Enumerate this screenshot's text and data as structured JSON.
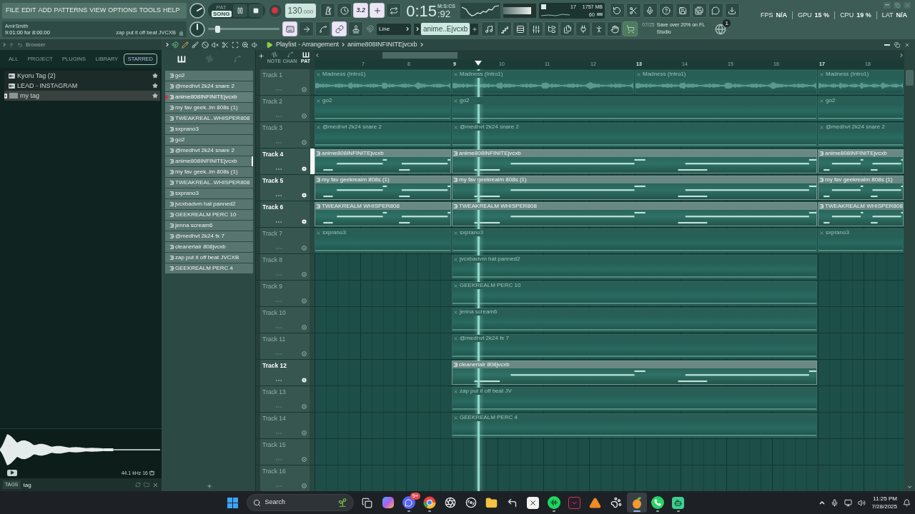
{
  "toolbar": {
    "menu": [
      "FILE",
      "EDIT",
      "ADD",
      "PATTERNS",
      "VIEW",
      "OPTIONS",
      "TOOLS",
      "HELP"
    ],
    "hint": {
      "title": "AmirSmith",
      "time": "9:01:00 for 8:00:00",
      "message": "zap put it off beat JVCXB"
    },
    "modes": [
      {
        "label": "PAT",
        "selected": false
      },
      {
        "label": "SONG",
        "selected": true
      }
    ],
    "tempo": {
      "value": "130",
      "decimals": ".000"
    },
    "toggles_top": [
      {
        "kind": "metronome",
        "on": false
      },
      {
        "kind": "wait",
        "on": false
      },
      {
        "kind": "countdown",
        "label": "3.2",
        "on": true
      },
      {
        "kind": "blend",
        "on": true
      },
      {
        "kind": "loop",
        "on": false
      }
    ],
    "time": {
      "value": "0:15",
      "centis": ":92",
      "unit": "M:S:CS"
    },
    "meter": {
      "level": 0.85
    },
    "usage": {
      "voices": "17",
      "memory": "1757 MB",
      "polyphony": "60"
    },
    "pitch": {
      "level": 0.13
    },
    "toggles_bottom": [
      {
        "kind": "typing",
        "on": true
      },
      {
        "kind": "arrow",
        "on": false
      },
      {
        "kind": "curve",
        "on": false
      },
      {
        "kind": "link",
        "on": true
      },
      {
        "kind": "stamp",
        "on": false
      }
    ],
    "snap": {
      "value": "Line"
    },
    "pattern": {
      "value": "anime..Ejvcxb"
    },
    "news": {
      "date": "07/25",
      "text": "Save over 20% on FL Studio",
      "badge": "1"
    },
    "stats": [
      {
        "label": "FPS",
        "value": "N/A"
      },
      {
        "label": "GPU",
        "value": "15 %"
      },
      {
        "label": "CPU",
        "value": "19 %"
      },
      {
        "label": "LAT",
        "value": "N/A"
      }
    ]
  },
  "browser": {
    "title": "Browser",
    "tabs": [
      {
        "label": "ALL",
        "selected": false
      },
      {
        "label": "PROJECT",
        "selected": false
      },
      {
        "label": "PLUGINS",
        "selected": false
      },
      {
        "label": "LIBRARY",
        "selected": false
      },
      {
        "label": "STARRED",
        "selected": true
      }
    ],
    "items": [
      {
        "kind": "folder",
        "label": "Kyoru Tag (2)",
        "selected": false,
        "starred": true
      },
      {
        "kind": "folder",
        "label": "LEAD - INSTAGRAM",
        "selected": false,
        "starred": true
      },
      {
        "kind": "tag",
        "label": "my tag",
        "selected": true,
        "starred": true
      }
    ],
    "preview": {
      "info": "44.1 kHz 16"
    },
    "tags": {
      "label": "TAGS",
      "value": "tag"
    }
  },
  "picker": {
    "tabs": [
      {
        "kind": "patterns",
        "selected": true
      },
      {
        "kind": "audio",
        "selected": false
      },
      {
        "kind": "automation",
        "selected": false
      }
    ],
    "items": [
      {
        "label": "go2",
        "selected": false,
        "current": false
      },
      {
        "label": "@medhvt 2k24 snare 2",
        "selected": false,
        "current": false
      },
      {
        "label": "anime808INFINITEjvcxb",
        "selected": true,
        "current": false
      },
      {
        "label": "my fav geek..lm 808s (1)",
        "selected": false,
        "current": false
      },
      {
        "label": "TWEAKREAL..WHISPER808",
        "selected": false,
        "current": false
      },
      {
        "label": "sxprano3",
        "selected": false,
        "current": false
      },
      {
        "label": "go2",
        "selected": false,
        "current": false
      },
      {
        "label": "@medhvt 2k24 snare 2",
        "selected": false,
        "current": false
      },
      {
        "label": "anime808INFINITEjvcxb",
        "selected": false,
        "current": true
      },
      {
        "label": "my fav geek..lm 808s (1)",
        "selected": false,
        "current": false
      },
      {
        "label": "TWEAKREAL..WHISPER808",
        "selected": false,
        "current": false
      },
      {
        "label": "sxprano3",
        "selected": false,
        "current": false
      },
      {
        "label": "jvcxbadvm hat panned2",
        "selected": false,
        "current": false
      },
      {
        "label": "GEEKREALM PERC 10",
        "selected": false,
        "current": false
      },
      {
        "label": "jenna scream6",
        "selected": false,
        "current": false
      },
      {
        "label": "@medhvt 2k24 fx 7",
        "selected": false,
        "current": false
      },
      {
        "label": "cleanerlair 808jvcxb",
        "selected": false,
        "current": false
      },
      {
        "label": "zap put it off beat JVCXB",
        "selected": false,
        "current": false
      },
      {
        "label": "GEEKREALM PERC 4",
        "selected": false,
        "current": false
      }
    ]
  },
  "playlist": {
    "title": "Playlist - Arrangement",
    "pattern": "anime808INFINITEjvcxb",
    "filters": [
      {
        "label": "NOTE",
        "selected": false
      },
      {
        "label": "CHAN",
        "selected": false
      },
      {
        "label": "PAT",
        "selected": true
      }
    ],
    "ruler": [
      "7",
      "8",
      "9",
      "10",
      "11",
      "12",
      "13",
      "14",
      "15",
      "16",
      "17",
      "18"
    ],
    "playhead": {
      "level": 0.278
    },
    "tracks": [
      {
        "name": "Track 1",
        "muted": true,
        "selected": false,
        "clips": [
          {
            "kind": "audio",
            "label": "Madness (Intro1)"
          },
          {
            "kind": "audio",
            "label": "Madness (Intro1)"
          },
          {
            "kind": "audio",
            "label": "Madness (Intro1)"
          },
          {
            "kind": "audio",
            "label": "Madness (Intro1)"
          }
        ]
      },
      {
        "name": "Track 2",
        "muted": true,
        "selected": false,
        "clips": [
          {
            "kind": "pattern",
            "label": "go2"
          },
          {
            "kind": "pattern",
            "label": "go2"
          },
          {
            "kind": "pattern",
            "label": "go2"
          }
        ]
      },
      {
        "name": "Track 3",
        "muted": true,
        "selected": false,
        "clips": [
          {
            "kind": "pattern",
            "label": "@medhvt 2k24 snare 2"
          },
          {
            "kind": "pattern",
            "label": "@medhvt 2k24 snare 2"
          },
          {
            "kind": "pattern",
            "label": "@medhvt 2k24 snare 2"
          }
        ]
      },
      {
        "name": "Track 4",
        "muted": false,
        "selected": true,
        "clips": [
          {
            "kind": "pattern",
            "label": "anime808INFINITEjvcxb"
          },
          {
            "kind": "pattern",
            "label": "anime808INFINITEjvcxb"
          },
          {
            "kind": "pattern",
            "label": "anime808INFINITEjvcxb"
          }
        ]
      },
      {
        "name": "Track 5",
        "muted": false,
        "selected": false,
        "clips": [
          {
            "kind": "pattern",
            "label": "my fav geekrealm 808s (1)"
          },
          {
            "kind": "pattern",
            "label": "my fav geekrealm 808s (1)"
          },
          {
            "kind": "pattern",
            "label": "my fav geekrealm 808s (1)"
          }
        ]
      },
      {
        "name": "Track 6",
        "muted": false,
        "selected": false,
        "clips": [
          {
            "kind": "pattern",
            "label": "TWEAKREALM WHISPER808"
          },
          {
            "kind": "pattern",
            "label": "TWEAKREALM WHISPER808"
          },
          {
            "kind": "pattern",
            "label": "TWEAKREALM WHISPER808"
          }
        ]
      },
      {
        "name": "Track 7",
        "muted": true,
        "selected": false,
        "clips": [
          {
            "kind": "pattern",
            "label": "sxprano3"
          },
          {
            "kind": "pattern",
            "label": "sxprano3"
          },
          {
            "kind": "pattern",
            "label": "sxprano3"
          }
        ]
      },
      {
        "name": "Track 8",
        "muted": true,
        "selected": false,
        "clips": [
          {
            "kind": "pattern",
            "label": "jvcxbadvm hat panned2"
          }
        ]
      },
      {
        "name": "Track 9",
        "muted": true,
        "selected": false,
        "clips": [
          {
            "kind": "pattern",
            "label": "GEEKREALM PERC 10"
          }
        ]
      },
      {
        "name": "Track 10",
        "muted": true,
        "selected": false,
        "clips": [
          {
            "kind": "pattern",
            "label": "jenna scream6"
          }
        ]
      },
      {
        "name": "Track 11",
        "muted": true,
        "selected": false,
        "clips": [
          {
            "kind": "pattern",
            "label": "@medhvt 2k24 fx 7"
          }
        ]
      },
      {
        "name": "Track 12",
        "muted": false,
        "selected": false,
        "clips": [
          {
            "kind": "pattern",
            "label": "cleanerlair 808jvcxb"
          }
        ]
      },
      {
        "name": "Track 13",
        "muted": true,
        "selected": false,
        "clips": [
          {
            "kind": "pattern",
            "label": "zap put it off beat JV"
          }
        ]
      },
      {
        "name": "Track 14",
        "muted": true,
        "selected": false,
        "clips": [
          {
            "kind": "pattern",
            "label": "GEEKREALM PERC 4"
          }
        ]
      },
      {
        "name": "Track 15",
        "muted": true,
        "selected": false
      },
      {
        "name": "Track 16",
        "muted": true,
        "selected": false
      }
    ]
  },
  "taskbar": {
    "search": {
      "placeholder": "Search"
    },
    "apps": [
      {
        "kind": "task-view",
        "running": false,
        "active": false
      },
      {
        "kind": "assistant",
        "running": false,
        "active": false
      },
      {
        "kind": "chat",
        "running": true,
        "active": false,
        "badge": "9+"
      },
      {
        "kind": "browser",
        "running": true,
        "active": false
      },
      {
        "kind": "capture",
        "running": false,
        "active": false
      },
      {
        "kind": "disc",
        "running": false,
        "active": false
      },
      {
        "kind": "folder",
        "running": false,
        "active": false
      },
      {
        "kind": "corner",
        "running": false,
        "active": false
      },
      {
        "kind": "editor",
        "running": false,
        "active": false
      },
      {
        "kind": "music",
        "running": true,
        "active": false
      },
      {
        "kind": "video",
        "running": false,
        "active": false
      },
      {
        "kind": "triangle",
        "running": false,
        "active": false
      },
      {
        "kind": "paw",
        "running": false,
        "active": false
      },
      {
        "kind": "daw",
        "running": true,
        "active": true
      },
      {
        "kind": "phone",
        "running": true,
        "active": false
      },
      {
        "kind": "bot",
        "running": true,
        "active": false
      }
    ],
    "clock": {
      "time": "11:25 PM",
      "date": "7/28/2025"
    }
  }
}
